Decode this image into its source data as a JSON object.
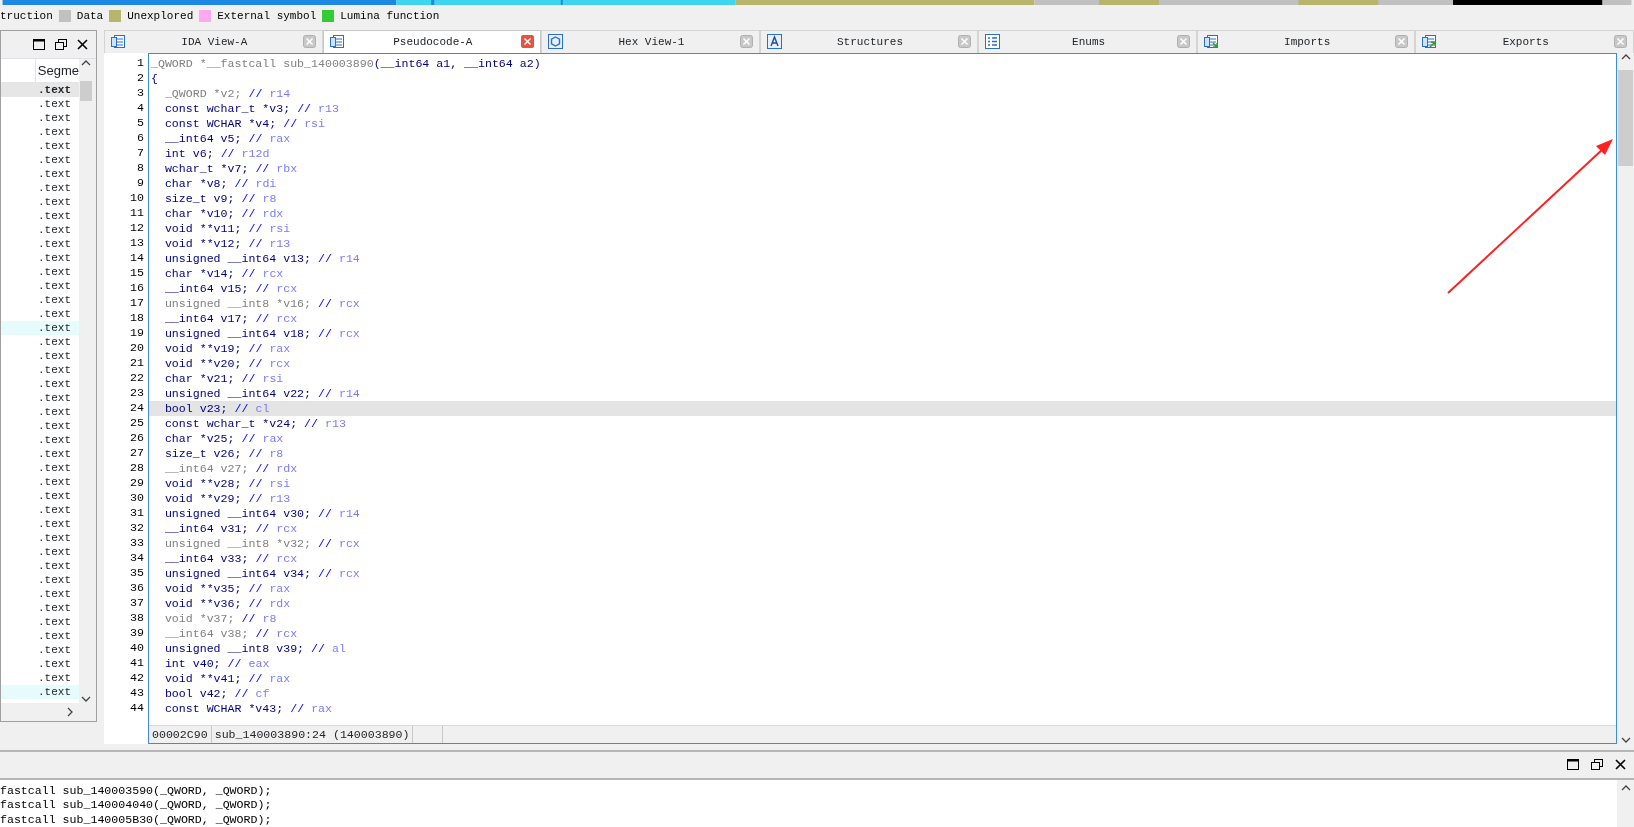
{
  "legend": [
    {
      "label": "truction"
    },
    {
      "label": "Data",
      "color": "#c0c0c0"
    },
    {
      "label": "Unexplored",
      "color": "#b7b46b"
    },
    {
      "label": "External symbol",
      "color": "#ffa8f0"
    },
    {
      "label": "Lumina function",
      "color": "#33cc33"
    }
  ],
  "segments_panel": {
    "column": "Segme",
    "items": [
      {
        "text": ".text",
        "selected": true,
        "highlighted": false
      },
      {
        "text": ".text",
        "selected": false,
        "highlighted": false
      },
      {
        "text": ".text",
        "selected": false,
        "highlighted": false
      },
      {
        "text": ".text",
        "selected": false,
        "highlighted": false
      },
      {
        "text": ".text",
        "selected": false,
        "highlighted": false
      },
      {
        "text": ".text",
        "selected": false,
        "highlighted": false
      },
      {
        "text": ".text",
        "selected": false,
        "highlighted": false
      },
      {
        "text": ".text",
        "selected": false,
        "highlighted": false
      },
      {
        "text": ".text",
        "selected": false,
        "highlighted": false
      },
      {
        "text": ".text",
        "selected": false,
        "highlighted": false
      },
      {
        "text": ".text",
        "selected": false,
        "highlighted": false
      },
      {
        "text": ".text",
        "selected": false,
        "highlighted": false
      },
      {
        "text": ".text",
        "selected": false,
        "highlighted": false
      },
      {
        "text": ".text",
        "selected": false,
        "highlighted": false
      },
      {
        "text": ".text",
        "selected": false,
        "highlighted": false
      },
      {
        "text": ".text",
        "selected": false,
        "highlighted": false
      },
      {
        "text": ".text",
        "selected": false,
        "highlighted": false
      },
      {
        "text": ".text",
        "selected": false,
        "highlighted": true
      },
      {
        "text": ".text",
        "selected": false,
        "highlighted": false
      },
      {
        "text": ".text",
        "selected": false,
        "highlighted": false
      },
      {
        "text": ".text",
        "selected": false,
        "highlighted": false
      },
      {
        "text": ".text",
        "selected": false,
        "highlighted": false
      },
      {
        "text": ".text",
        "selected": false,
        "highlighted": false
      },
      {
        "text": ".text",
        "selected": false,
        "highlighted": false
      },
      {
        "text": ".text",
        "selected": false,
        "highlighted": false
      },
      {
        "text": ".text",
        "selected": false,
        "highlighted": false
      },
      {
        "text": ".text",
        "selected": false,
        "highlighted": false
      },
      {
        "text": ".text",
        "selected": false,
        "highlighted": false
      },
      {
        "text": ".text",
        "selected": false,
        "highlighted": false
      },
      {
        "text": ".text",
        "selected": false,
        "highlighted": false
      },
      {
        "text": ".text",
        "selected": false,
        "highlighted": false
      },
      {
        "text": ".text",
        "selected": false,
        "highlighted": false
      },
      {
        "text": ".text",
        "selected": false,
        "highlighted": false
      },
      {
        "text": ".text",
        "selected": false,
        "highlighted": false
      },
      {
        "text": ".text",
        "selected": false,
        "highlighted": false
      },
      {
        "text": ".text",
        "selected": false,
        "highlighted": false
      },
      {
        "text": ".text",
        "selected": false,
        "highlighted": false
      },
      {
        "text": ".text",
        "selected": false,
        "highlighted": false
      },
      {
        "text": ".text",
        "selected": false,
        "highlighted": false
      },
      {
        "text": ".text",
        "selected": false,
        "highlighted": false
      },
      {
        "text": ".text",
        "selected": false,
        "highlighted": false
      },
      {
        "text": ".text",
        "selected": false,
        "highlighted": false
      },
      {
        "text": ".text",
        "selected": false,
        "highlighted": false
      },
      {
        "text": ".text",
        "selected": false,
        "highlighted": true
      }
    ]
  },
  "tabs": [
    {
      "label": "IDA View-A",
      "kind": "disassembly",
      "selected": false
    },
    {
      "label": "Pseudocode-A",
      "kind": "pseudocode",
      "selected": true
    },
    {
      "label": "Hex View-1",
      "kind": "hex",
      "selected": false
    },
    {
      "label": "Structures",
      "kind": "structures",
      "selected": false
    },
    {
      "label": "Enums",
      "kind": "enums",
      "selected": false
    },
    {
      "label": "Imports",
      "kind": "imports",
      "selected": false
    },
    {
      "label": "Exports",
      "kind": "exports",
      "selected": false
    }
  ],
  "code_lines": [
    {
      "number": "1",
      "code": "_QWORD *__fastcall sub_140003890",
      "tail": "(__int64 a1, __int64 a2)",
      "dimmed": true,
      "selected": false
    },
    {
      "number": "2",
      "code": "{",
      "dimmed": false,
      "selected": false
    },
    {
      "number": "3",
      "code": "  _QWORD *v2;",
      "slashes": "//",
      "register": "r14",
      "dimmed": true,
      "selected": false
    },
    {
      "number": "4",
      "code": "  const wchar_t *v3;",
      "slashes": "//",
      "register": "r13",
      "dimmed": false,
      "selected": false
    },
    {
      "number": "5",
      "code": "  const WCHAR *v4;",
      "slashes": "//",
      "register": "rsi",
      "dimmed": false,
      "selected": false
    },
    {
      "number": "6",
      "code": "  __int64 v5;",
      "slashes": "//",
      "register": "rax",
      "dimmed": false,
      "selected": false
    },
    {
      "number": "7",
      "code": "  int v6;",
      "slashes": "//",
      "register": "r12d",
      "dimmed": false,
      "selected": false
    },
    {
      "number": "8",
      "code": "  wchar_t *v7;",
      "slashes": "//",
      "register": "rbx",
      "dimmed": false,
      "selected": false
    },
    {
      "number": "9",
      "code": "  char *v8;",
      "slashes": "//",
      "register": "rdi",
      "dimmed": false,
      "selected": false
    },
    {
      "number": "10",
      "code": "  size_t v9;",
      "slashes": "//",
      "register": "r8",
      "dimmed": false,
      "selected": false
    },
    {
      "number": "11",
      "code": "  char *v10;",
      "slashes": "//",
      "register": "rdx",
      "dimmed": false,
      "selected": false
    },
    {
      "number": "12",
      "code": "  void **v11;",
      "slashes": "//",
      "register": "rsi",
      "dimmed": false,
      "selected": false
    },
    {
      "number": "13",
      "code": "  void **v12;",
      "slashes": "//",
      "register": "r13",
      "dimmed": false,
      "selected": false
    },
    {
      "number": "14",
      "code": "  unsigned __int64 v13;",
      "slashes": "//",
      "register": "r14",
      "dimmed": false,
      "selected": false
    },
    {
      "number": "15",
      "code": "  char *v14;",
      "slashes": "//",
      "register": "rcx",
      "dimmed": false,
      "selected": false
    },
    {
      "number": "16",
      "code": "  __int64 v15;",
      "slashes": "//",
      "register": "rcx",
      "dimmed": false,
      "selected": false
    },
    {
      "number": "17",
      "code": "  unsigned __int8 *v16;",
      "slashes": "//",
      "register": "rcx",
      "dimmed": true,
      "selected": false
    },
    {
      "number": "18",
      "code": "  __int64 v17;",
      "slashes": "//",
      "register": "rcx",
      "dimmed": false,
      "selected": false
    },
    {
      "number": "19",
      "code": "  unsigned __int64 v18;",
      "slashes": "//",
      "register": "rcx",
      "dimmed": false,
      "selected": false
    },
    {
      "number": "20",
      "code": "  void **v19;",
      "slashes": "//",
      "register": "rax",
      "dimmed": false,
      "selected": false
    },
    {
      "number": "21",
      "code": "  void **v20;",
      "slashes": "//",
      "register": "rcx",
      "dimmed": false,
      "selected": false
    },
    {
      "number": "22",
      "code": "  char *v21;",
      "slashes": "//",
      "register": "rsi",
      "dimmed": false,
      "selected": false
    },
    {
      "number": "23",
      "code": "  unsigned __int64 v22;",
      "slashes": "//",
      "register": "r14",
      "dimmed": false,
      "selected": false
    },
    {
      "number": "24",
      "code": "  bool v23;",
      "slashes": "//",
      "register": "cl",
      "dimmed": false,
      "selected": true
    },
    {
      "number": "25",
      "code": "  const wchar_t *v24;",
      "slashes": "//",
      "register": "r13",
      "dimmed": false,
      "selected": false
    },
    {
      "number": "26",
      "code": "  char *v25;",
      "slashes": "//",
      "register": "rax",
      "dimmed": false,
      "selected": false
    },
    {
      "number": "27",
      "code": "  size_t v26;",
      "slashes": "//",
      "register": "r8",
      "dimmed": false,
      "selected": false
    },
    {
      "number": "28",
      "code": "  __int64 v27;",
      "slashes": "//",
      "register": "rdx",
      "dimmed": true,
      "selected": false
    },
    {
      "number": "29",
      "code": "  void **v28;",
      "slashes": "//",
      "register": "rsi",
      "dimmed": false,
      "selected": false
    },
    {
      "number": "30",
      "code": "  void **v29;",
      "slashes": "//",
      "register": "r13",
      "dimmed": false,
      "selected": false
    },
    {
      "number": "31",
      "code": "  unsigned __int64 v30;",
      "slashes": "//",
      "register": "r14",
      "dimmed": false,
      "selected": false
    },
    {
      "number": "32",
      "code": "  __int64 v31;",
      "slashes": "//",
      "register": "rcx",
      "dimmed": false,
      "selected": false
    },
    {
      "number": "33",
      "code": "  unsigned __int8 *v32;",
      "slashes": "//",
      "register": "rcx",
      "dimmed": true,
      "selected": false
    },
    {
      "number": "34",
      "code": "  __int64 v33;",
      "slashes": "//",
      "register": "rcx",
      "dimmed": false,
      "selected": false
    },
    {
      "number": "35",
      "code": "  unsigned __int64 v34;",
      "slashes": "//",
      "register": "rcx",
      "dimmed": false,
      "selected": false
    },
    {
      "number": "36",
      "code": "  void **v35;",
      "slashes": "//",
      "register": "rax",
      "dimmed": false,
      "selected": false
    },
    {
      "number": "37",
      "code": "  void **v36;",
      "slashes": "//",
      "register": "rdx",
      "dimmed": false,
      "selected": false
    },
    {
      "number": "38",
      "code": "  void *v37;",
      "slashes": "//",
      "register": "r8",
      "dimmed": true,
      "selected": false
    },
    {
      "number": "39",
      "code": "  __int64 v38;",
      "slashes": "//",
      "register": "rcx",
      "dimmed": true,
      "selected": false
    },
    {
      "number": "40",
      "code": "  unsigned __int8 v39;",
      "slashes": "//",
      "register": "al",
      "dimmed": false,
      "selected": false
    },
    {
      "number": "41",
      "code": "  int v40;",
      "slashes": "//",
      "register": "eax",
      "dimmed": false,
      "selected": false
    },
    {
      "number": "42",
      "code": "  void **v41;",
      "slashes": "//",
      "register": "rax",
      "dimmed": false,
      "selected": false
    },
    {
      "number": "43",
      "code": "  bool v42;",
      "slashes": "//",
      "register": "cf",
      "dimmed": false,
      "selected": false
    },
    {
      "number": "44",
      "code": "  const WCHAR *v43;",
      "slashes": "//",
      "register": "rax",
      "dimmed": false,
      "selected": false
    }
  ],
  "status_bar": {
    "offset": "00002C90",
    "location": "sub_140003890:24 (140003890)"
  },
  "output_lines": [
    "fastcall sub_140003590(_QWORD, _QWORD);",
    "fastcall sub_140004040(_QWORD, _QWORD);",
    "fastcall sub_140005B30(_QWORD, _QWORD);"
  ]
}
